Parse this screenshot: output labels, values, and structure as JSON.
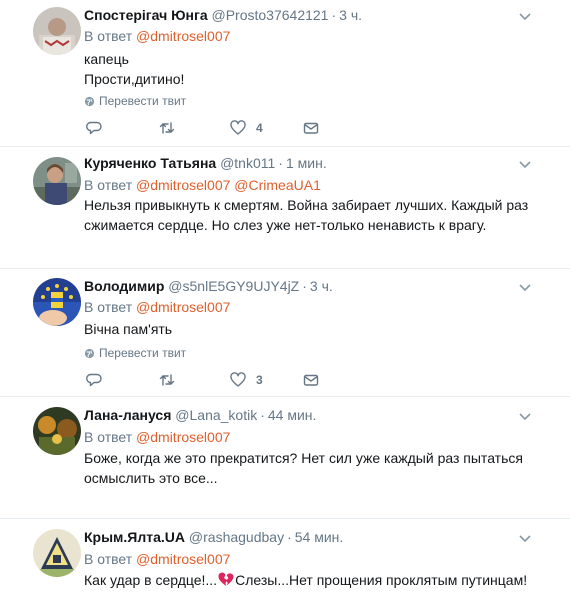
{
  "tweets": [
    {
      "name": "Спостерігач Юнга",
      "handle": "@Prosto37642121",
      "time": "3 ч.",
      "reply_prefix": "В ответ",
      "mentions": [
        "@dmitrosel007"
      ],
      "lines": [
        "капець",
        "Прости,дитино!"
      ],
      "translate": "Перевести твит",
      "likes": "4"
    },
    {
      "name": "Куряченко Татьяна",
      "handle": "@tnk011",
      "time": "1 мин.",
      "reply_prefix": "В ответ",
      "mentions": [
        "@dmitrosel007",
        "@CrimeaUA1"
      ],
      "lines": [
        "Нельзя привыкнуть к смертям. Война забирает лучших. Каждый раз",
        "сжимается сердце. Но слез уже нет-только ненависть к врагу."
      ]
    },
    {
      "name": "Володимир",
      "handle": "@s5nlE5GY9UJY4jZ",
      "time": "3 ч.",
      "reply_prefix": "В ответ",
      "mentions": [
        "@dmitrosel007"
      ],
      "lines": [
        "Вічна пам'ять"
      ],
      "translate": "Перевести твит",
      "likes": "3"
    },
    {
      "name": "Лана-лануся",
      "handle": "@Lana_kotik",
      "time": "44 мин.",
      "reply_prefix": "В ответ",
      "mentions": [
        "@dmitrosel007"
      ],
      "lines": [
        "Боже, когда же это прекратится? Нет сил уже каждый раз пытаться",
        "осмыслить это все..."
      ]
    },
    {
      "name": "Крым.Ялта.UA",
      "handle": "@rashagudbay",
      "time": "54 мин.",
      "reply_prefix": "В ответ",
      "mentions": [
        "@dmitrosel007"
      ],
      "text_before_emoji": "Как удар в сердце!...",
      "text_after_emoji": "Слезы...Нет прощения проклятым путинцам!"
    }
  ],
  "icons": {
    "reply": "reply-icon",
    "retweet": "retweet-icon",
    "like": "heart-icon",
    "dm": "envelope-icon",
    "more": "chevron-down-icon",
    "translate": "globe-icon",
    "emoji": "broken-heart-icon"
  },
  "colors": {
    "mention": "#e0602d",
    "muted": "#657786",
    "text": "#14171a",
    "divider": "#e6ecf0",
    "broken_heart": "#e0245e"
  }
}
